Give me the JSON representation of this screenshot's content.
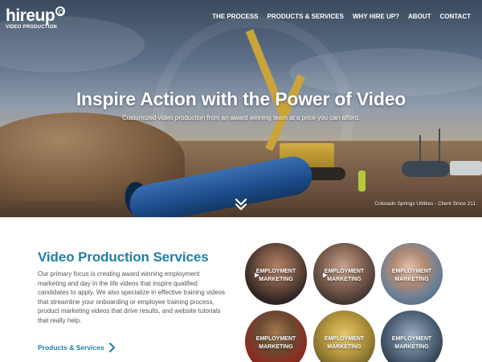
{
  "logo": {
    "word": "hireup",
    "tagline": "VIDEO PRODUCTION"
  },
  "nav": {
    "items": [
      {
        "label": "THE PROCESS"
      },
      {
        "label": "PRODUCTS & SERVICES"
      },
      {
        "label": "WHY HIRE UP?"
      },
      {
        "label": "ABOUT"
      },
      {
        "label": "CONTACT"
      }
    ]
  },
  "hero": {
    "title": "Inspire Action with the Power of Video",
    "subtitle": "Customized video production from an award winning team at a price you can afford.",
    "caption": "Colorado Springs Utilities - Client Since 211",
    "scroll_icon": "double-chevron-down-icon"
  },
  "services": {
    "heading": "Video Production Services",
    "body": "Our primary focus is creating award winning employment marketing and day in the life videos that inspire qualified candidates to apply. We also specialize in effective training videos that streamline your onboarding or employee training process, product marketing videos that drive results, and website tutorials that really help.",
    "link_label": "Products & Services",
    "link_icon": "chevron-right-icon",
    "tiles": [
      {
        "label": "EMPLOYMENT MARKETING",
        "play_icon": true
      },
      {
        "label": "EMPLOYMENT MARKETING",
        "play_icon": true
      },
      {
        "label": "EMPLOYMENT MARKETING",
        "play_icon": false
      },
      {
        "label": "EMPLOYMENT MARKETING",
        "play_icon": false
      },
      {
        "label": "EMPLOYMENT MARKETING",
        "play_icon": false
      },
      {
        "label": "EMPLOYMENT MARKETING",
        "play_icon": false
      }
    ]
  },
  "colors": {
    "accent": "#1f7fa8",
    "body_text": "#555555",
    "white": "#ffffff"
  }
}
